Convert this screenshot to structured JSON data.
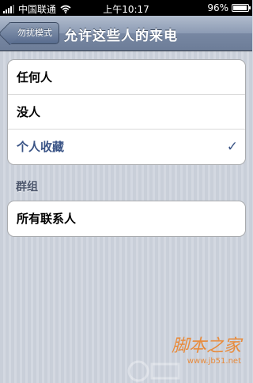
{
  "status_bar": {
    "carrier": "中国联通",
    "time": "上午10:17",
    "battery_percent_label": "96%",
    "battery_level": 0.96
  },
  "nav": {
    "back_label": "勿扰模式",
    "title": "允许这些人的来电"
  },
  "allow_options": [
    {
      "label": "任何人",
      "selected": false
    },
    {
      "label": "没人",
      "selected": false
    },
    {
      "label": "个人收藏",
      "selected": true
    }
  ],
  "check_glyph": "✓",
  "groups_section": {
    "header": "群组",
    "items": [
      {
        "label": "所有联系人"
      }
    ]
  },
  "watermark": {
    "text": "脚本之家",
    "url": "www.jb51.net"
  },
  "colors": {
    "nav_bar": "#7f8fab",
    "selected_text": "#3a5486",
    "background": "#cfd4dd"
  },
  "icons": [
    "signal-icon",
    "wifi-icon",
    "battery-icon",
    "checkmark-icon"
  ]
}
